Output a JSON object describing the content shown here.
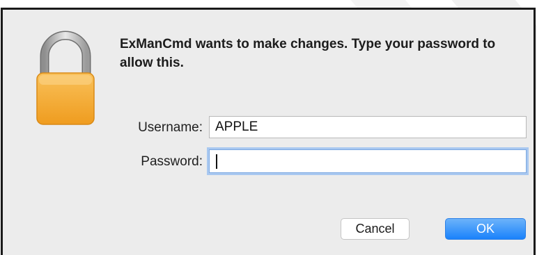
{
  "dialog": {
    "message": "ExManCmd wants to make changes. Type your password to allow this.",
    "icon": "lock-icon",
    "username_label": "Username:",
    "username_value": "APPLE",
    "password_label": "Password:",
    "password_value": "",
    "cancel_label": "Cancel",
    "ok_label": "OK",
    "accent_color": "#1a82fb"
  }
}
